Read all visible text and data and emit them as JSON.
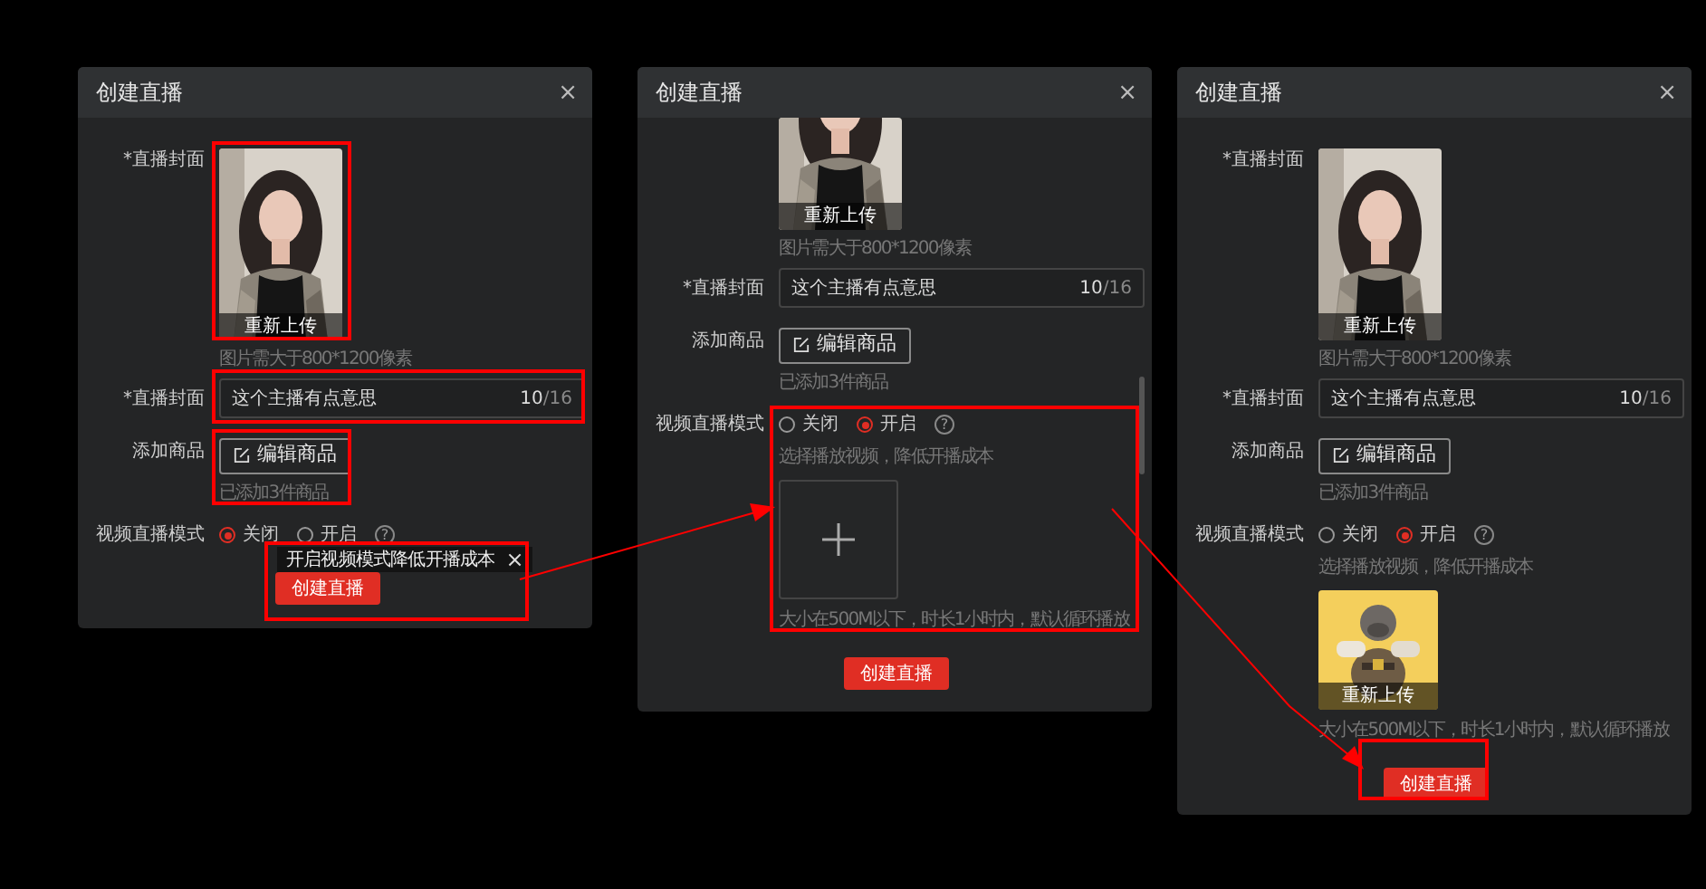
{
  "dialogs": [
    {
      "title": "创建直播",
      "close": "×",
      "cover": {
        "label": "*直播封面",
        "overlay": "重新上传",
        "hint": "图片需大于800*1200像素"
      },
      "name_field": {
        "label": "*直播封面",
        "value": "这个主播有点意思",
        "count": "10",
        "limit": "/16"
      },
      "products": {
        "label": "添加商品",
        "button": "编辑商品",
        "hint": "已添加3件商品"
      },
      "video_mode": {
        "label": "视频直播模式",
        "options": [
          {
            "label": "关闭",
            "selected": true
          },
          {
            "label": "开启",
            "selected": false
          }
        ],
        "help": "?"
      },
      "tooltip": {
        "text": "开启视频模式降低开播成本",
        "close": "×"
      },
      "submit": "创建直播"
    },
    {
      "title": "创建直播",
      "close": "×",
      "scrolled": true,
      "cover": {
        "overlay": "重新上传",
        "hint": "图片需大于800*1200像素"
      },
      "name_field": {
        "label": "*直播封面",
        "value": "这个主播有点意思",
        "count": "10",
        "limit": "/16"
      },
      "products": {
        "label": "添加商品",
        "button": "编辑商品",
        "hint": "已添加3件商品"
      },
      "video_mode": {
        "label": "视频直播模式",
        "options": [
          {
            "label": "关闭",
            "selected": false
          },
          {
            "label": "开启",
            "selected": true
          }
        ],
        "help": "?",
        "hint": "选择播放视频，降低开播成本",
        "upload": {
          "kind": "empty"
        },
        "size_hint": "大小在500M以下，时长1小时内，默认循环播放"
      },
      "submit": "创建直播"
    },
    {
      "title": "创建直播",
      "close": "×",
      "cover": {
        "label": "*直播封面",
        "overlay": "重新上传",
        "hint": "图片需大于800*1200像素"
      },
      "name_field": {
        "label": "*直播封面",
        "value": "这个主播有点意思",
        "count": "10",
        "limit": "/16"
      },
      "products": {
        "label": "添加商品",
        "button": "编辑商品",
        "hint": "已添加3件商品"
      },
      "video_mode": {
        "label": "视频直播模式",
        "options": [
          {
            "label": "关闭",
            "selected": false
          },
          {
            "label": "开启",
            "selected": true
          }
        ],
        "help": "?",
        "hint": "选择播放视频，降低开播成本",
        "upload": {
          "kind": "picture",
          "overlay": "重新上传"
        },
        "size_hint": "大小在500M以下，时长1小时内，默认循环播放"
      },
      "submit": "创建直播"
    }
  ]
}
